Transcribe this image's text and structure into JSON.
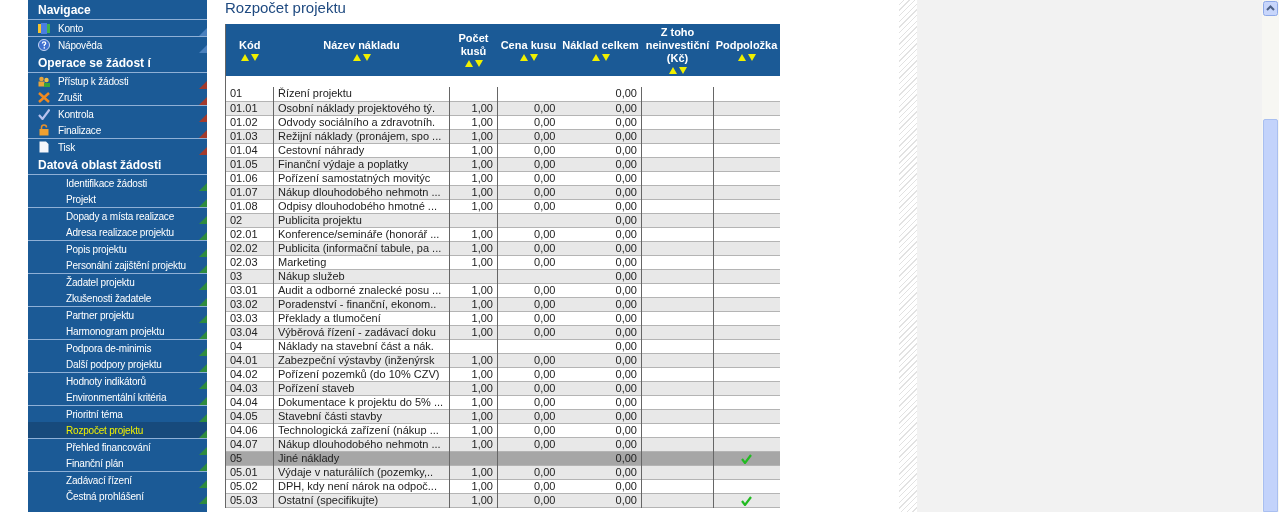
{
  "sidebar": {
    "sections": [
      {
        "title": "Navigace",
        "color": "#4a80bd",
        "groups": [
          {
            "items": [
              {
                "label": "Konto",
                "selected": false
              }
            ]
          },
          {
            "items": [
              {
                "label": "Nápověda",
                "selected": false
              }
            ]
          }
        ]
      },
      {
        "title": "Operace se žádost í",
        "color": "#a33a2c",
        "groups": [
          {
            "items": [
              {
                "label": "Přístup k žádosti",
                "selected": false
              },
              {
                "label": "Zrušit",
                "selected": false
              }
            ]
          },
          {
            "items": [
              {
                "label": "Kontrola",
                "selected": false
              },
              {
                "label": "Finalizace",
                "selected": false
              }
            ]
          },
          {
            "items": [
              {
                "label": "Tisk",
                "selected": false
              }
            ]
          }
        ]
      },
      {
        "title": "Datová oblast žádosti",
        "color": "#2e8b3e",
        "groups": [
          {
            "items": [
              {
                "label": "Identifikace žádosti",
                "selected": false
              },
              {
                "label": "Projekt",
                "selected": false
              }
            ]
          },
          {
            "items": [
              {
                "label": "Dopady a místa realizace",
                "selected": false
              },
              {
                "label": "Adresa realizace projektu",
                "selected": false
              }
            ]
          },
          {
            "items": [
              {
                "label": "Popis projektu",
                "selected": false
              },
              {
                "label": "Personální zajištění projektu",
                "selected": false
              }
            ]
          },
          {
            "items": [
              {
                "label": "Žadatel projektu",
                "selected": false
              },
              {
                "label": "Zkušenosti žadatele",
                "selected": false
              }
            ]
          },
          {
            "items": [
              {
                "label": "Partner projektu",
                "selected": false
              },
              {
                "label": "Harmonogram projektu",
                "selected": false
              }
            ]
          },
          {
            "items": [
              {
                "label": "Podpora de-minimis",
                "selected": false
              },
              {
                "label": "Další podpory projektu",
                "selected": false
              }
            ]
          },
          {
            "items": [
              {
                "label": "Hodnoty indikátorů",
                "selected": false
              },
              {
                "label": "Environmentální kritéria",
                "selected": false
              }
            ]
          },
          {
            "items": [
              {
                "label": "Prioritní téma",
                "selected": false
              },
              {
                "label": "Rozpočet projektu",
                "selected": true
              }
            ]
          },
          {
            "items": [
              {
                "label": "Přehled financování",
                "selected": false
              },
              {
                "label": "Finanční plán",
                "selected": false
              }
            ]
          },
          {
            "items": [
              {
                "label": "Zadávací řízení",
                "selected": false
              },
              {
                "label": "Čestná prohlášení",
                "selected": false
              }
            ]
          }
        ]
      }
    ]
  },
  "page_title": "Rozpočet projektu",
  "table": {
    "columns": [
      "Kód",
      "Název nákladu",
      "Počet kusů",
      "Cena kusu",
      "Náklad celkem",
      "Z toho neinvestiční (Kč)",
      "Podpoložka"
    ],
    "rows": [
      {
        "code": "01",
        "name": "Řízení projektu",
        "total": "0,00",
        "selected": false,
        "subitem": false
      },
      {
        "code": "01.01",
        "name": "Osobní náklady projektového tý.",
        "count": "1,00",
        "price": "0,00",
        "total": "0,00",
        "selected": false,
        "subitem": false
      },
      {
        "code": "01.02",
        "name": "Odvody sociálního a zdravotníh.",
        "count": "1,00",
        "price": "0,00",
        "total": "0,00",
        "selected": false,
        "subitem": false
      },
      {
        "code": "01.03",
        "name": "Režijní náklady (pronájem, spo ...",
        "count": "1,00",
        "price": "0,00",
        "total": "0,00",
        "selected": false,
        "subitem": false
      },
      {
        "code": "01.04",
        "name": "Cestovní náhrady",
        "count": "1,00",
        "price": "0,00",
        "total": "0,00",
        "selected": false,
        "subitem": false
      },
      {
        "code": "01.05",
        "name": "Finanční výdaje a poplatky",
        "count": "1,00",
        "price": "0,00",
        "total": "0,00",
        "selected": false,
        "subitem": false
      },
      {
        "code": "01.06",
        "name": "Pořízení samostatných movitýc",
        "count": "1,00",
        "price": "0,00",
        "total": "0,00",
        "selected": false,
        "subitem": false
      },
      {
        "code": "01.07",
        "name": "Nákup dlouhodobého nehmotn ...",
        "count": "1,00",
        "price": "0,00",
        "total": "0,00",
        "selected": false,
        "subitem": false
      },
      {
        "code": "01.08",
        "name": "Odpisy dlouhodobého hmotné ...",
        "count": "1,00",
        "price": "0,00",
        "total": "0,00",
        "selected": false,
        "subitem": false
      },
      {
        "code": "02",
        "name": "Publicita projektu",
        "total": "0,00",
        "selected": false,
        "subitem": false
      },
      {
        "code": "02.01",
        "name": "Konference/semináře (honorář ...",
        "count": "1,00",
        "price": "0,00",
        "total": "0,00",
        "selected": false,
        "subitem": false
      },
      {
        "code": "02.02",
        "name": "Publicita (informační tabule, pa ...",
        "count": "1,00",
        "price": "0,00",
        "total": "0,00",
        "selected": false,
        "subitem": false
      },
      {
        "code": "02.03",
        "name": "Marketing",
        "count": "1,00",
        "price": "0,00",
        "total": "0,00",
        "selected": false,
        "subitem": false
      },
      {
        "code": "03",
        "name": "Nákup služeb",
        "total": "0,00",
        "selected": false,
        "subitem": false
      },
      {
        "code": "03.01",
        "name": "Audit a odborné znalecké posu ...",
        "count": "1,00",
        "price": "0,00",
        "total": "0,00",
        "selected": false,
        "subitem": false
      },
      {
        "code": "03.02",
        "name": "Poradenství - finanční, ekonom..",
        "count": "1,00",
        "price": "0,00",
        "total": "0,00",
        "selected": false,
        "subitem": false
      },
      {
        "code": "03.03",
        "name": "Překlady a tlumočení",
        "count": "1,00",
        "price": "0,00",
        "total": "0,00",
        "selected": false,
        "subitem": false
      },
      {
        "code": "03.04",
        "name": "Výběrová řízení - zadávací doku",
        "count": "1,00",
        "price": "0,00",
        "total": "0,00",
        "selected": false,
        "subitem": false
      },
      {
        "code": "04",
        "name": "Náklady na stavební část a nák.",
        "total": "0,00",
        "selected": false,
        "subitem": false
      },
      {
        "code": "04.01",
        "name": "Zabezpeční výstavby (inženýrsk",
        "count": "1,00",
        "price": "0,00",
        "total": "0,00",
        "selected": false,
        "subitem": false
      },
      {
        "code": "04.02",
        "name": "Pořízení pozemků (do 10% CZV)",
        "count": "1,00",
        "price": "0,00",
        "total": "0,00",
        "selected": false,
        "subitem": false
      },
      {
        "code": "04.03",
        "name": "Pořízení staveb",
        "count": "1,00",
        "price": "0,00",
        "total": "0,00",
        "selected": false,
        "subitem": false
      },
      {
        "code": "04.04",
        "name": "Dokumentace k projektu do 5% ...",
        "count": "1,00",
        "price": "0,00",
        "total": "0,00",
        "selected": false,
        "subitem": false
      },
      {
        "code": "04.05",
        "name": "Stavební části stavby",
        "count": "1,00",
        "price": "0,00",
        "total": "0,00",
        "selected": false,
        "subitem": false
      },
      {
        "code": "04.06",
        "name": "Technologická zařízení (nákup ...",
        "count": "1,00",
        "price": "0,00",
        "total": "0,00",
        "selected": false,
        "subitem": false
      },
      {
        "code": "04.07",
        "name": "Nákup dlouhodobého nehmotn ...",
        "count": "1,00",
        "price": "0,00",
        "total": "0,00",
        "selected": false,
        "subitem": false
      },
      {
        "code": "05",
        "name": "Jiné náklady",
        "total": "0,00",
        "selected": true,
        "subitem": true
      },
      {
        "code": "05.01",
        "name": "Výdaje v naturáliích (pozemky,..",
        "count": "1,00",
        "price": "0,00",
        "total": "0,00",
        "selected": false,
        "subitem": false
      },
      {
        "code": "05.02",
        "name": "DPH, kdy není nárok na odpoč...",
        "count": "1,00",
        "price": "0,00",
        "total": "0,00",
        "selected": false,
        "subitem": false
      },
      {
        "code": "05.03",
        "name": "Ostatní (specifikujte)",
        "count": "1,00",
        "price": "0,00",
        "total": "0,00",
        "selected": false,
        "subitem": true
      }
    ]
  }
}
